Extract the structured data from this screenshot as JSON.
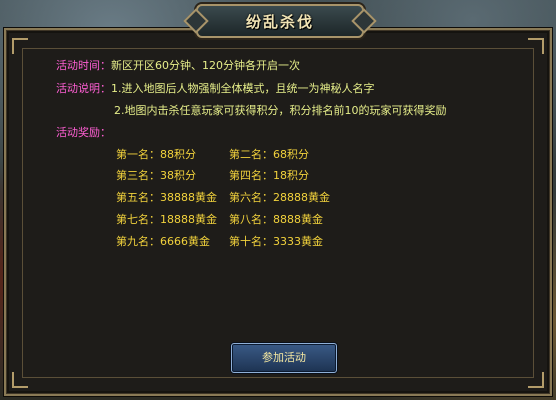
{
  "dialog": {
    "title": "纷乱杀伐"
  },
  "info": {
    "time_label": "活动时间：",
    "time_value": "新区开区60分钟、120分钟各开启一次",
    "desc_label": "活动说明：",
    "desc_line1": "1.进入地图后人物强制全体模式，且统一为神秘人名字",
    "desc_line2": "2.地图内击杀任意玩家可获得积分，积分排名前10的玩家可获得奖励",
    "reward_label": "活动奖励："
  },
  "rewards": [
    "第一名：88积分",
    "第二名：68积分",
    "第三名：38积分",
    "第四名：18积分",
    "第五名：38888黄金",
    "第六名：28888黄金",
    "第七名：18888黄金",
    "第八名：8888黄金",
    "第九名：6666黄金",
    "第十名：3333黄金"
  ],
  "join_button": "参加活动",
  "colors": {
    "label": "#ff5fd4",
    "value": "#e6ee8a",
    "reward": "#f2d23c",
    "frame": "#8a7a56"
  }
}
